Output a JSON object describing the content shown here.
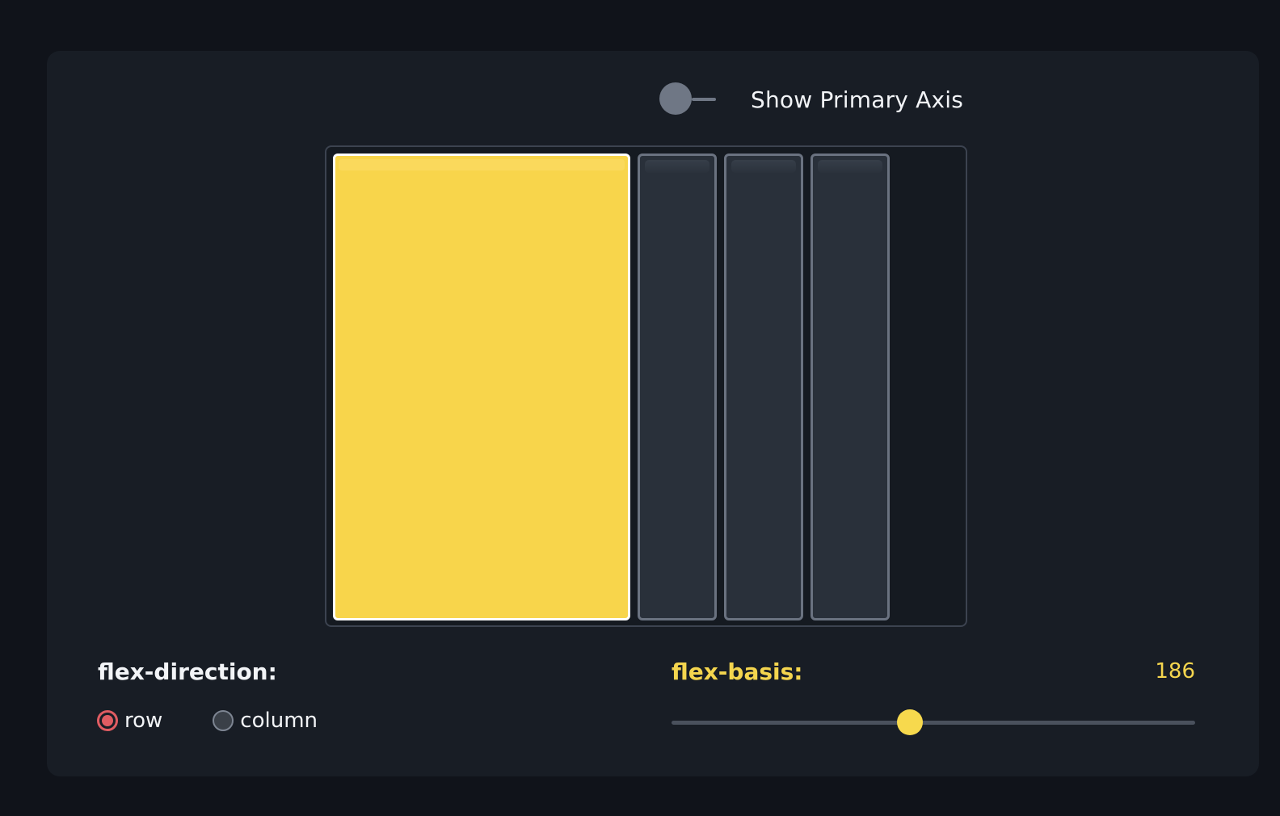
{
  "toggle": {
    "label": "Show Primary Axis",
    "on": false
  },
  "flex_container": {
    "items": [
      {
        "role": "primary",
        "color": "#f8d54b"
      },
      {
        "role": "secondary",
        "color": "#29303a"
      },
      {
        "role": "secondary",
        "color": "#29303a"
      },
      {
        "role": "secondary",
        "color": "#29303a"
      }
    ]
  },
  "flex_direction": {
    "label": "flex-direction:",
    "options": [
      {
        "label": "row",
        "checked": true
      },
      {
        "label": "column",
        "checked": false
      }
    ]
  },
  "flex_basis": {
    "label": "flex-basis:",
    "value": "186",
    "slider_fraction": 0.455
  },
  "colors": {
    "accent_yellow": "#f4d54e",
    "radio_checked": "#e05c62",
    "background": "#10131a",
    "card": "#181d25"
  }
}
